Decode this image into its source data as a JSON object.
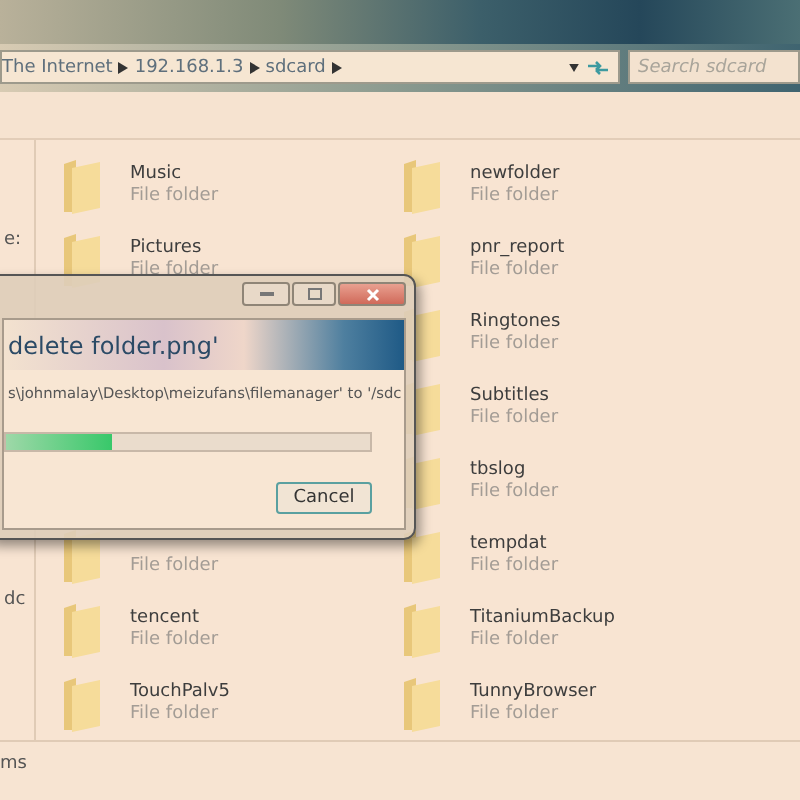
{
  "address_bar": {
    "crumbs": [
      "The Internet",
      "192.168.1.3",
      "sdcard"
    ]
  },
  "search": {
    "placeholder": "Search sdcard"
  },
  "nav_pane": {
    "items": [
      "e:",
      "dc"
    ]
  },
  "folders_left": [
    {
      "name": "Music",
      "type": "File folder"
    },
    {
      "name": "Pictures",
      "type": "File folder"
    },
    {
      "type": "File folder"
    },
    {
      "name": "tencent",
      "type": "File folder"
    },
    {
      "name": "TouchPalv5",
      "type": "File folder"
    }
  ],
  "folders_right": [
    {
      "name": "newfolder",
      "type": "File folder"
    },
    {
      "name": "pnr_report",
      "type": "File folder"
    },
    {
      "name": "Ringtones",
      "type": "File folder"
    },
    {
      "name": "Subtitles",
      "type": "File folder"
    },
    {
      "name": "tbslog",
      "type": "File folder"
    },
    {
      "name": "tempdat",
      "type": "File folder"
    },
    {
      "name": "TitaniumBackup",
      "type": "File folder"
    },
    {
      "name": "TunnyBrowser",
      "type": "File folder"
    }
  ],
  "status_bar": {
    "text": "ms"
  },
  "dialog": {
    "heading": "delete folder.png'",
    "detail": "s\\johnmalay\\Desktop\\meizufans\\filemanager' to '/sdc",
    "progress": {
      "level": 0.29
    },
    "buttons": [
      "Cancel"
    ]
  }
}
